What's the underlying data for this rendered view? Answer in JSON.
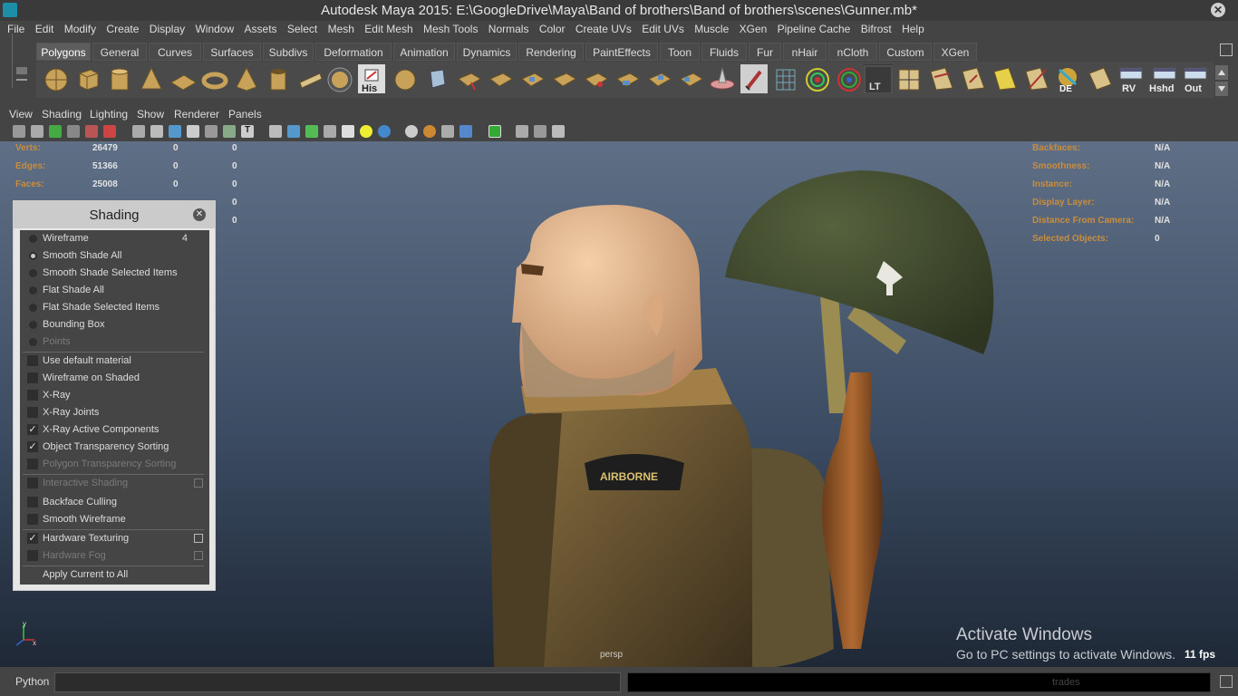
{
  "window": {
    "title": "Autodesk Maya 2015: E:\\GoogleDrive\\Maya\\Band of brothers\\Band of brothers\\scenes\\Gunner.mb*"
  },
  "menubar": [
    "File",
    "Edit",
    "Modify",
    "Create",
    "Display",
    "Window",
    "Assets",
    "Select",
    "Mesh",
    "Edit Mesh",
    "Mesh Tools",
    "Normals",
    "Color",
    "Create UVs",
    "Edit UVs",
    "Muscle",
    "XGen",
    "Pipeline Cache",
    "Bifrost",
    "Help"
  ],
  "shelf": {
    "tabs": [
      "Polygons",
      "General",
      "Curves",
      "Surfaces",
      "Subdivs",
      "Deformation",
      "Animation",
      "Dynamics",
      "Rendering",
      "PaintEffects",
      "Toon",
      "Fluids",
      "Fur",
      "nHair",
      "nCloth",
      "Custom",
      "XGen"
    ],
    "active_tab": "Polygons",
    "icon_labels": {
      "his": "His",
      "lt": "LT",
      "de": "DE",
      "rv": "RV",
      "hshd": "Hshd",
      "out": "Out"
    }
  },
  "panel_menu": [
    "View",
    "Shading",
    "Lighting",
    "Show",
    "Renderer",
    "Panels"
  ],
  "hud_left": {
    "rows": [
      {
        "label": "Verts:",
        "v1": "26479",
        "v2": "0",
        "v3": "0"
      },
      {
        "label": "Edges:",
        "v1": "51366",
        "v2": "0",
        "v3": "0"
      },
      {
        "label": "Faces:",
        "v1": "25008",
        "v2": "0",
        "v3": "0"
      },
      {
        "label": "",
        "v1": "",
        "v2": "",
        "v3": "0"
      },
      {
        "label": "",
        "v1": "",
        "v2": "",
        "v3": "0"
      }
    ]
  },
  "hud_right": {
    "rows": [
      {
        "label": "Backfaces:",
        "value": "N/A"
      },
      {
        "label": "Smoothness:",
        "value": "N/A"
      },
      {
        "label": "Instance:",
        "value": "N/A"
      },
      {
        "label": "Display Layer:",
        "value": "N/A"
      },
      {
        "label": "Distance From Camera:",
        "value": "N/A"
      },
      {
        "label": "Selected Objects:",
        "value": "0"
      }
    ]
  },
  "shading_panel": {
    "title": "Shading",
    "radio_items": [
      {
        "label": "Wireframe",
        "badge": "4"
      },
      {
        "label": "Smooth Shade All",
        "selected": true
      },
      {
        "label": "Smooth Shade Selected Items"
      },
      {
        "label": "Flat Shade All"
      },
      {
        "label": "Flat Shade Selected Items"
      },
      {
        "label": "Bounding Box"
      },
      {
        "label": "Points",
        "disabled": true
      }
    ],
    "check_items": [
      {
        "label": "Use default material"
      },
      {
        "label": "Wireframe on Shaded"
      },
      {
        "label": "X-Ray"
      },
      {
        "label": "X-Ray Joints"
      },
      {
        "label": "X-Ray Active Components",
        "checked": true
      },
      {
        "label": "Object Transparency Sorting",
        "checked": true
      },
      {
        "label": "Polygon Transparency Sorting",
        "disabled": true
      }
    ],
    "check_items2": [
      {
        "label": "Interactive Shading",
        "disabled": true
      },
      {
        "label": "Backface Culling"
      },
      {
        "label": "Smooth Wireframe"
      }
    ],
    "check_items3": [
      {
        "label": "Hardware Texturing",
        "checked": true
      },
      {
        "label": "Hardware Fog",
        "disabled": true
      }
    ],
    "apply": "Apply Current to All"
  },
  "viewport": {
    "camera": "persp",
    "fps": "11 fps",
    "patch_text": "AIRBORNE",
    "axis_x": "x",
    "axis_y": "y"
  },
  "watermark": {
    "line1": "Activate Windows",
    "line2": "Go to PC settings to activate Windows."
  },
  "command_line": {
    "label": "Python",
    "result_text": "trades"
  }
}
